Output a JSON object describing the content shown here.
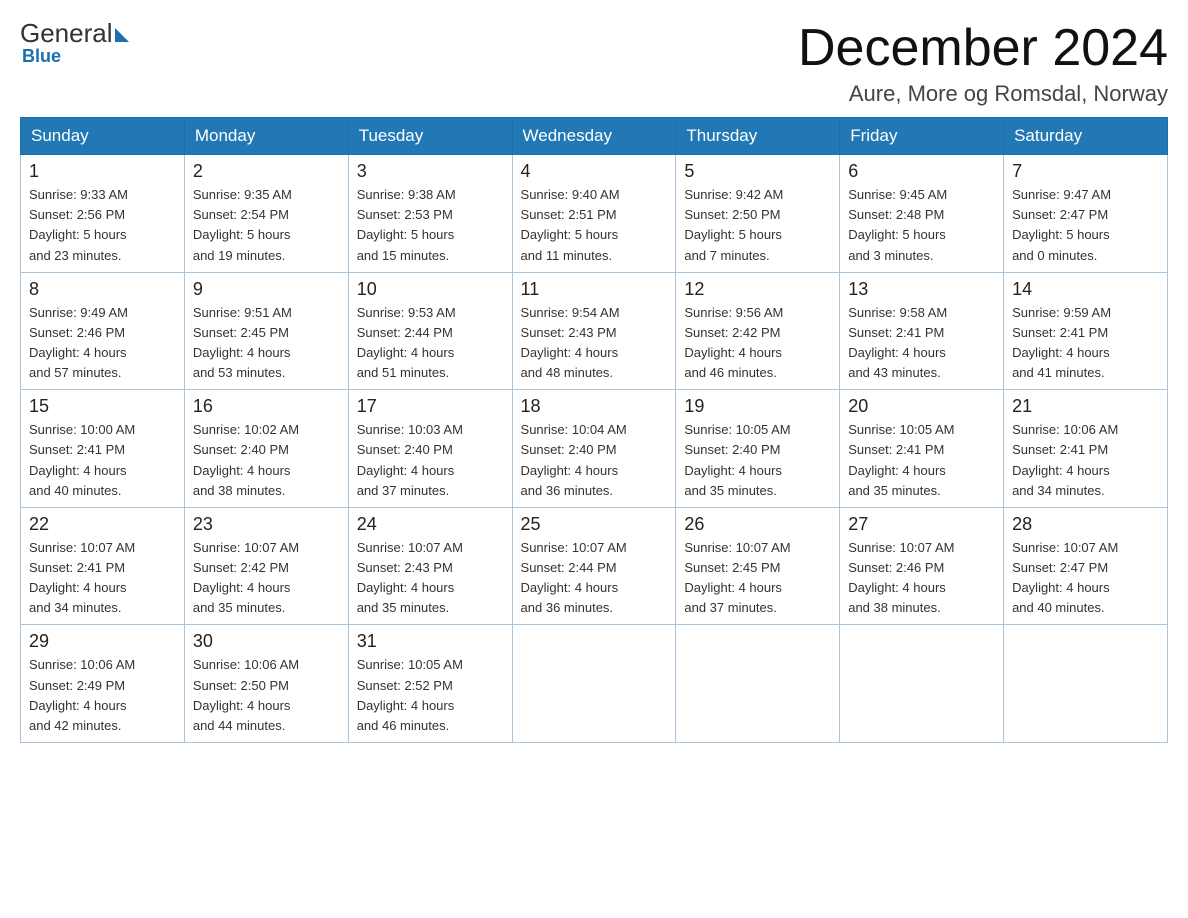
{
  "logo": {
    "general": "General",
    "blue": "Blue"
  },
  "header": {
    "month": "December 2024",
    "location": "Aure, More og Romsdal, Norway"
  },
  "days_of_week": [
    "Sunday",
    "Monday",
    "Tuesday",
    "Wednesday",
    "Thursday",
    "Friday",
    "Saturday"
  ],
  "weeks": [
    [
      {
        "day": "1",
        "sunrise": "9:33 AM",
        "sunset": "2:56 PM",
        "daylight": "5 hours and 23 minutes."
      },
      {
        "day": "2",
        "sunrise": "9:35 AM",
        "sunset": "2:54 PM",
        "daylight": "5 hours and 19 minutes."
      },
      {
        "day": "3",
        "sunrise": "9:38 AM",
        "sunset": "2:53 PM",
        "daylight": "5 hours and 15 minutes."
      },
      {
        "day": "4",
        "sunrise": "9:40 AM",
        "sunset": "2:51 PM",
        "daylight": "5 hours and 11 minutes."
      },
      {
        "day": "5",
        "sunrise": "9:42 AM",
        "sunset": "2:50 PM",
        "daylight": "5 hours and 7 minutes."
      },
      {
        "day": "6",
        "sunrise": "9:45 AM",
        "sunset": "2:48 PM",
        "daylight": "5 hours and 3 minutes."
      },
      {
        "day": "7",
        "sunrise": "9:47 AM",
        "sunset": "2:47 PM",
        "daylight": "5 hours and 0 minutes."
      }
    ],
    [
      {
        "day": "8",
        "sunrise": "9:49 AM",
        "sunset": "2:46 PM",
        "daylight": "4 hours and 57 minutes."
      },
      {
        "day": "9",
        "sunrise": "9:51 AM",
        "sunset": "2:45 PM",
        "daylight": "4 hours and 53 minutes."
      },
      {
        "day": "10",
        "sunrise": "9:53 AM",
        "sunset": "2:44 PM",
        "daylight": "4 hours and 51 minutes."
      },
      {
        "day": "11",
        "sunrise": "9:54 AM",
        "sunset": "2:43 PM",
        "daylight": "4 hours and 48 minutes."
      },
      {
        "day": "12",
        "sunrise": "9:56 AM",
        "sunset": "2:42 PM",
        "daylight": "4 hours and 46 minutes."
      },
      {
        "day": "13",
        "sunrise": "9:58 AM",
        "sunset": "2:41 PM",
        "daylight": "4 hours and 43 minutes."
      },
      {
        "day": "14",
        "sunrise": "9:59 AM",
        "sunset": "2:41 PM",
        "daylight": "4 hours and 41 minutes."
      }
    ],
    [
      {
        "day": "15",
        "sunrise": "10:00 AM",
        "sunset": "2:41 PM",
        "daylight": "4 hours and 40 minutes."
      },
      {
        "day": "16",
        "sunrise": "10:02 AM",
        "sunset": "2:40 PM",
        "daylight": "4 hours and 38 minutes."
      },
      {
        "day": "17",
        "sunrise": "10:03 AM",
        "sunset": "2:40 PM",
        "daylight": "4 hours and 37 minutes."
      },
      {
        "day": "18",
        "sunrise": "10:04 AM",
        "sunset": "2:40 PM",
        "daylight": "4 hours and 36 minutes."
      },
      {
        "day": "19",
        "sunrise": "10:05 AM",
        "sunset": "2:40 PM",
        "daylight": "4 hours and 35 minutes."
      },
      {
        "day": "20",
        "sunrise": "10:05 AM",
        "sunset": "2:41 PM",
        "daylight": "4 hours and 35 minutes."
      },
      {
        "day": "21",
        "sunrise": "10:06 AM",
        "sunset": "2:41 PM",
        "daylight": "4 hours and 34 minutes."
      }
    ],
    [
      {
        "day": "22",
        "sunrise": "10:07 AM",
        "sunset": "2:41 PM",
        "daylight": "4 hours and 34 minutes."
      },
      {
        "day": "23",
        "sunrise": "10:07 AM",
        "sunset": "2:42 PM",
        "daylight": "4 hours and 35 minutes."
      },
      {
        "day": "24",
        "sunrise": "10:07 AM",
        "sunset": "2:43 PM",
        "daylight": "4 hours and 35 minutes."
      },
      {
        "day": "25",
        "sunrise": "10:07 AM",
        "sunset": "2:44 PM",
        "daylight": "4 hours and 36 minutes."
      },
      {
        "day": "26",
        "sunrise": "10:07 AM",
        "sunset": "2:45 PM",
        "daylight": "4 hours and 37 minutes."
      },
      {
        "day": "27",
        "sunrise": "10:07 AM",
        "sunset": "2:46 PM",
        "daylight": "4 hours and 38 minutes."
      },
      {
        "day": "28",
        "sunrise": "10:07 AM",
        "sunset": "2:47 PM",
        "daylight": "4 hours and 40 minutes."
      }
    ],
    [
      {
        "day": "29",
        "sunrise": "10:06 AM",
        "sunset": "2:49 PM",
        "daylight": "4 hours and 42 minutes."
      },
      {
        "day": "30",
        "sunrise": "10:06 AM",
        "sunset": "2:50 PM",
        "daylight": "4 hours and 44 minutes."
      },
      {
        "day": "31",
        "sunrise": "10:05 AM",
        "sunset": "2:52 PM",
        "daylight": "4 hours and 46 minutes."
      },
      null,
      null,
      null,
      null
    ]
  ],
  "labels": {
    "sunrise": "Sunrise:",
    "sunset": "Sunset:",
    "daylight": "Daylight:"
  }
}
